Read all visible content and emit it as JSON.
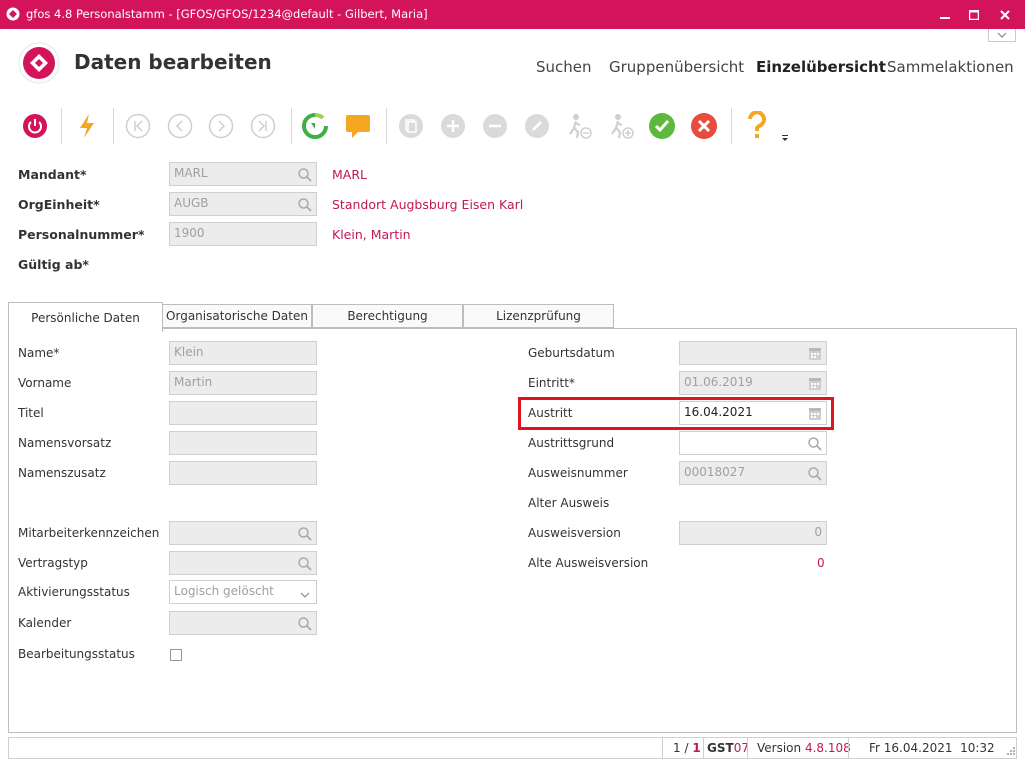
{
  "window": {
    "title": "gfos 4.8  Personalstamm - [GFOS/GFOS/1234@default - Gilbert, Maria]",
    "brand_color": "#d4145a"
  },
  "header": {
    "page_title": "Daten bearbeiten",
    "nav": [
      "Suchen",
      "Gruppenübersicht",
      "Einzelübersicht",
      "Sammelaktionen"
    ],
    "active_nav": "Einzelübersicht"
  },
  "toolbar": {
    "icons": [
      "power-icon",
      "lightning-icon",
      "first-icon",
      "previous-icon",
      "next-icon",
      "last-icon",
      "refresh-icon",
      "comment-icon",
      "copy-icon",
      "add-icon",
      "remove-icon",
      "edit-icon",
      "person-exit-icon",
      "person-add-icon",
      "confirm-icon",
      "cancel-icon",
      "help-icon",
      "overflow-icon"
    ]
  },
  "top_form": {
    "mandant": {
      "label": "Mandant*",
      "value": "MARL",
      "description": "MARL"
    },
    "orgeinheit": {
      "label": "OrgEinheit*",
      "value": "AUGB",
      "description": "Standort Augbsburg Eisen Karl"
    },
    "personalnummer": {
      "label": "Personalnummer*",
      "value": "1900",
      "description": "Klein, Martin"
    },
    "gueltig_ab": {
      "label": "Gültig ab*"
    }
  },
  "tabs": [
    "Persönliche Daten",
    "Organisatorische Daten",
    "Berechtigung",
    "Lizenzprüfung"
  ],
  "left_form": {
    "name": {
      "label": "Name*",
      "value": "Klein"
    },
    "vorname": {
      "label": "Vorname",
      "value": "Martin"
    },
    "titel": {
      "label": "Titel",
      "value": ""
    },
    "namensvorsatz": {
      "label": "Namensvorsatz",
      "value": ""
    },
    "namenszusatz": {
      "label": "Namenszusatz",
      "value": ""
    },
    "mitarbeiterkennzeichen": {
      "label": "Mitarbeiterkennzeichen",
      "value": ""
    },
    "vertragstyp": {
      "label": "Vertragstyp",
      "value": ""
    },
    "aktivierungsstatus": {
      "label": "Aktivierungsstatus",
      "value": "Logisch gelöscht"
    },
    "kalender": {
      "label": "Kalender",
      "value": ""
    },
    "bearbeitungsstatus": {
      "label": "Bearbeitungsstatus",
      "checked": false
    }
  },
  "right_form": {
    "geburtsdatum": {
      "label": "Geburtsdatum",
      "value": "  .  ."
    },
    "eintritt": {
      "label": "Eintritt*",
      "value": "01.06.2019"
    },
    "austritt": {
      "label": "Austritt",
      "value": "16.04.2021"
    },
    "austrittsgrund": {
      "label": "Austrittsgrund",
      "value": ""
    },
    "ausweisnummer": {
      "label": "Ausweisnummer",
      "value": "00018027"
    },
    "alter_ausweis": {
      "label": "Alter Ausweis"
    },
    "ausweisversion": {
      "label": "Ausweisversion",
      "value": "0"
    },
    "alte_ausweisversion": {
      "label": "Alte Ausweisversion",
      "value": "0"
    }
  },
  "statusbar": {
    "record_current": "1 /",
    "record_total": "1",
    "gst_prefix": "GST",
    "gst_number": "07",
    "version_label": "Version",
    "version_value": "4.8.108",
    "datetime": "Fr 16.04.2021  10:32"
  }
}
